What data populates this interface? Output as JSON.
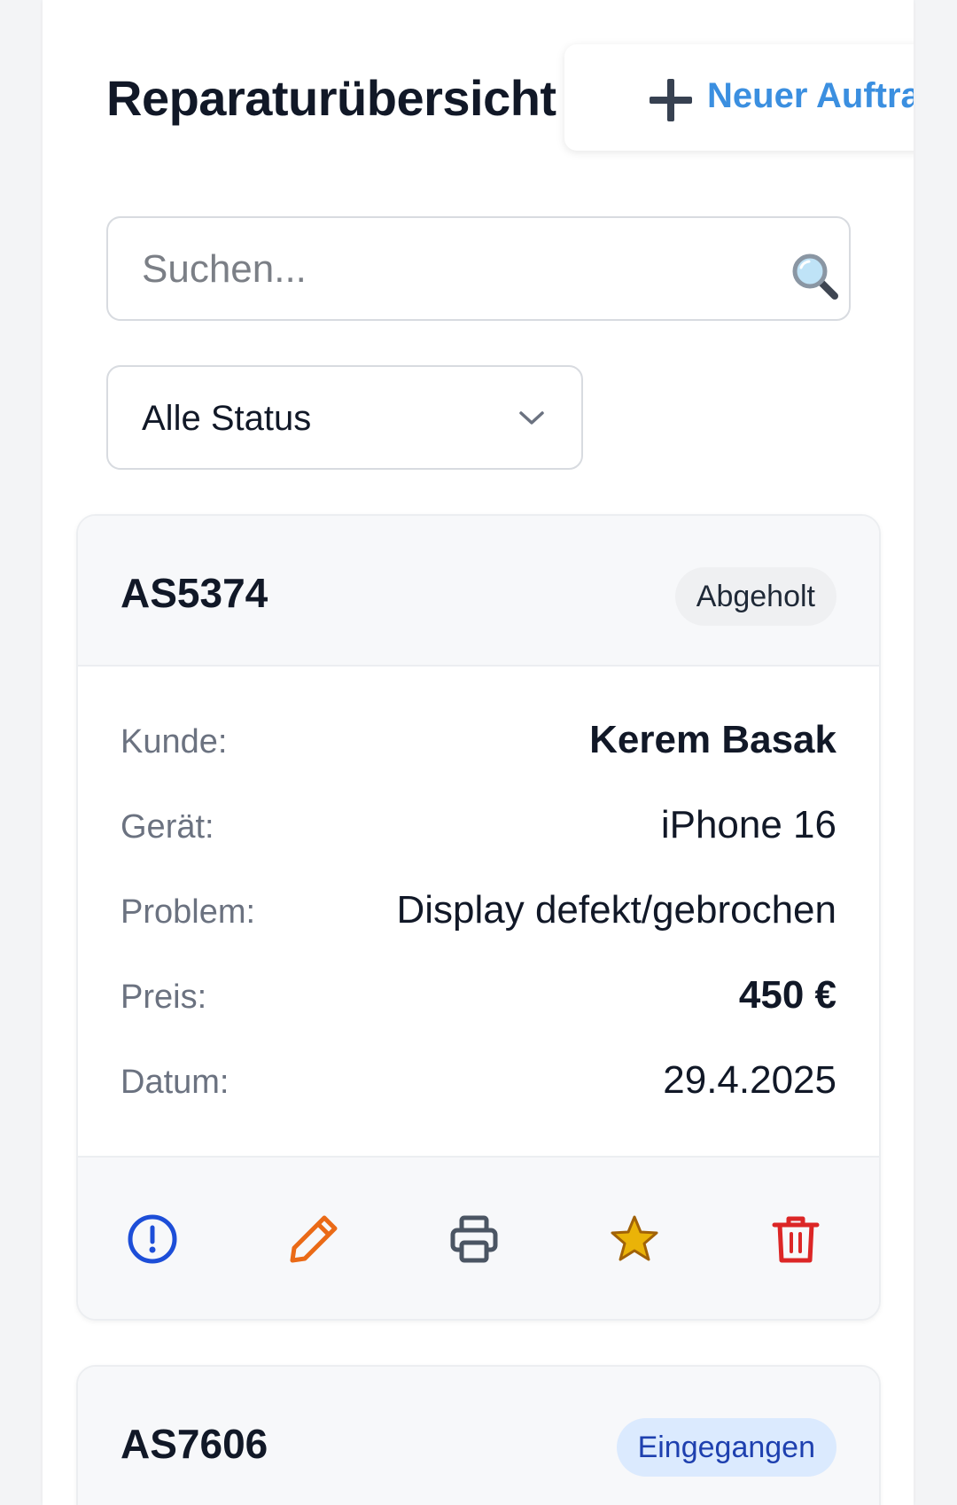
{
  "header": {
    "title": "Reparaturübersicht",
    "new_order_label": "Neuer Auftrag"
  },
  "search": {
    "placeholder": "Suchen..."
  },
  "filter": {
    "status_selected": "Alle Status"
  },
  "labels": {
    "customer": "Kunde:",
    "device": "Gerät:",
    "problem": "Problem:",
    "price": "Preis:",
    "date": "Datum:"
  },
  "orders": [
    {
      "id": "AS5374",
      "status": "Abgeholt",
      "customer": "Kerem Basak",
      "device": "iPhone 16",
      "problem": "Display defekt/gebrochen",
      "price": "450 €",
      "date": "29.4.2025"
    },
    {
      "id": "AS7606",
      "status": "Eingegangen"
    }
  ],
  "actions": [
    "info-icon",
    "edit-icon",
    "print-icon",
    "star-icon",
    "trash-icon"
  ],
  "colors": {
    "accent": "#3b8fe0",
    "info": "#1d4ed8",
    "edit": "#ea6a17",
    "print": "#4b5563",
    "star": "#eab308",
    "delete": "#dc2626",
    "badge_blue_bg": "#dbeafe",
    "badge_gray_bg": "#eff0f2"
  }
}
